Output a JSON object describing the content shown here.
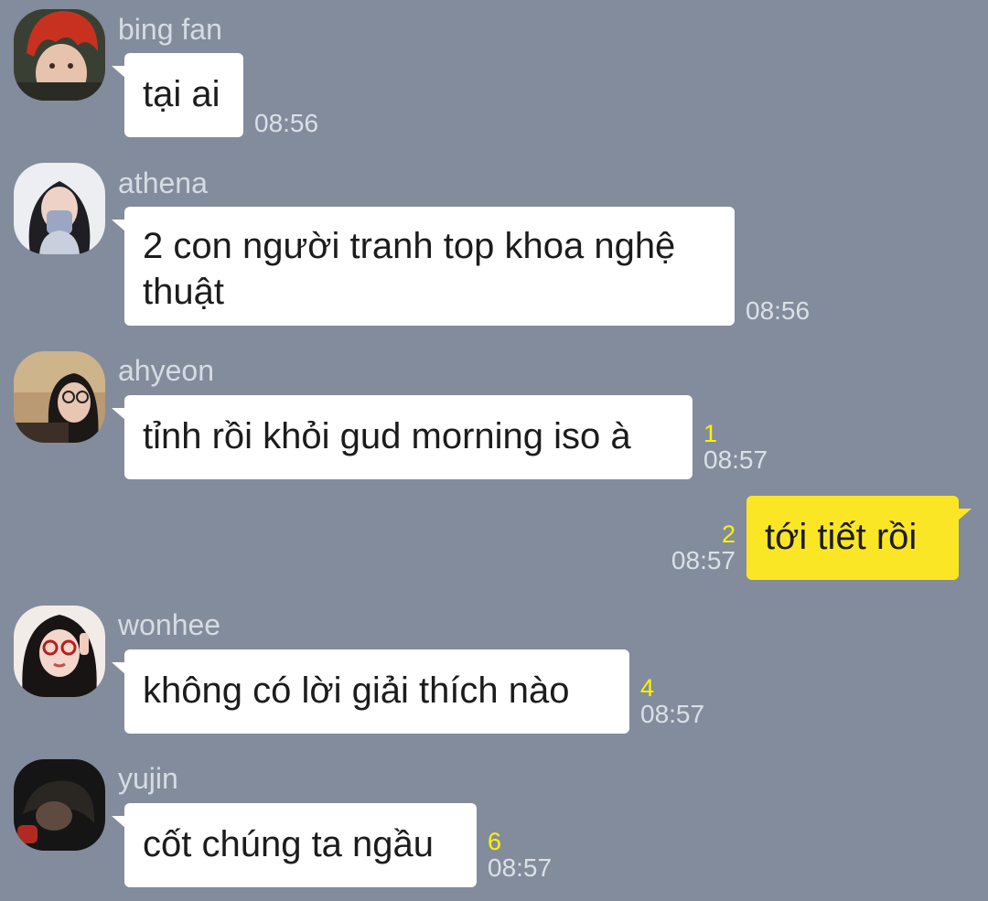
{
  "messages": [
    {
      "sender": "bing fan",
      "text": "tại ai",
      "time": "08:56",
      "unread": "",
      "avatar": "avatar-bing-fan"
    },
    {
      "sender": "athena",
      "text": "2 con người tranh top khoa nghệ thuật",
      "time": "08:56",
      "unread": "",
      "avatar": "avatar-athena"
    },
    {
      "sender": "ahyeon",
      "text": "tỉnh rồi khỏi gud morning iso à",
      "time": "08:57",
      "unread": "1",
      "avatar": "avatar-ahyeon"
    },
    {
      "sender": "",
      "text": "tới tiết rồi",
      "time": "08:57",
      "unread": "2",
      "outgoing": true
    },
    {
      "sender": "wonhee",
      "text": "không có lời giải thích nào",
      "time": "08:57",
      "unread": "4",
      "avatar": "avatar-wonhee"
    },
    {
      "sender": "yujin",
      "text": "cốt chúng ta ngầu",
      "time": "08:57",
      "unread": "6",
      "avatar": "avatar-yujin"
    }
  ],
  "colors": {
    "background": "#838c9c",
    "incoming_bubble": "#ffffff",
    "outgoing_bubble": "#fbe626",
    "unread_count": "#fff200",
    "meta_text": "#dbe0e8"
  }
}
